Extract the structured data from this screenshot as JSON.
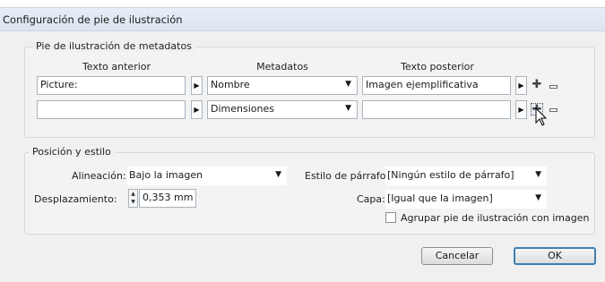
{
  "window": {
    "title": "Configuración de pie de ilustración"
  },
  "metadata_section": {
    "legend": "Pie de ilustración de metadatos",
    "headers": {
      "before": "Texto anterior",
      "metadata": "Metadatos",
      "after": "Texto posterior"
    },
    "rows": [
      {
        "before": "Picture:",
        "metadata": "Nombre",
        "after": "Imagen ejemplificativa"
      },
      {
        "before": "",
        "metadata": "Dimensiones",
        "after": ""
      }
    ]
  },
  "position_section": {
    "legend": "Posición y estilo",
    "alignment_label": "Alineación:",
    "alignment_value": "Bajo la imagen",
    "offset_label": "Desplazamiento:",
    "offset_value": "0,353 mm",
    "paragraph_style_label": "Estilo de párrafo:",
    "paragraph_style_value": "[Ningún estilo de párrafo]",
    "layer_label": "Capa:",
    "layer_value": "[Igual que la imagen]",
    "group_checkbox_label": "Agrupar pie de ilustración con imagen",
    "group_checked": false
  },
  "buttons": {
    "cancel": "Cancelar",
    "ok": "OK"
  },
  "colors": {
    "titlebar": "#dbe6f2",
    "default_button_border": "#3c7fb1"
  }
}
